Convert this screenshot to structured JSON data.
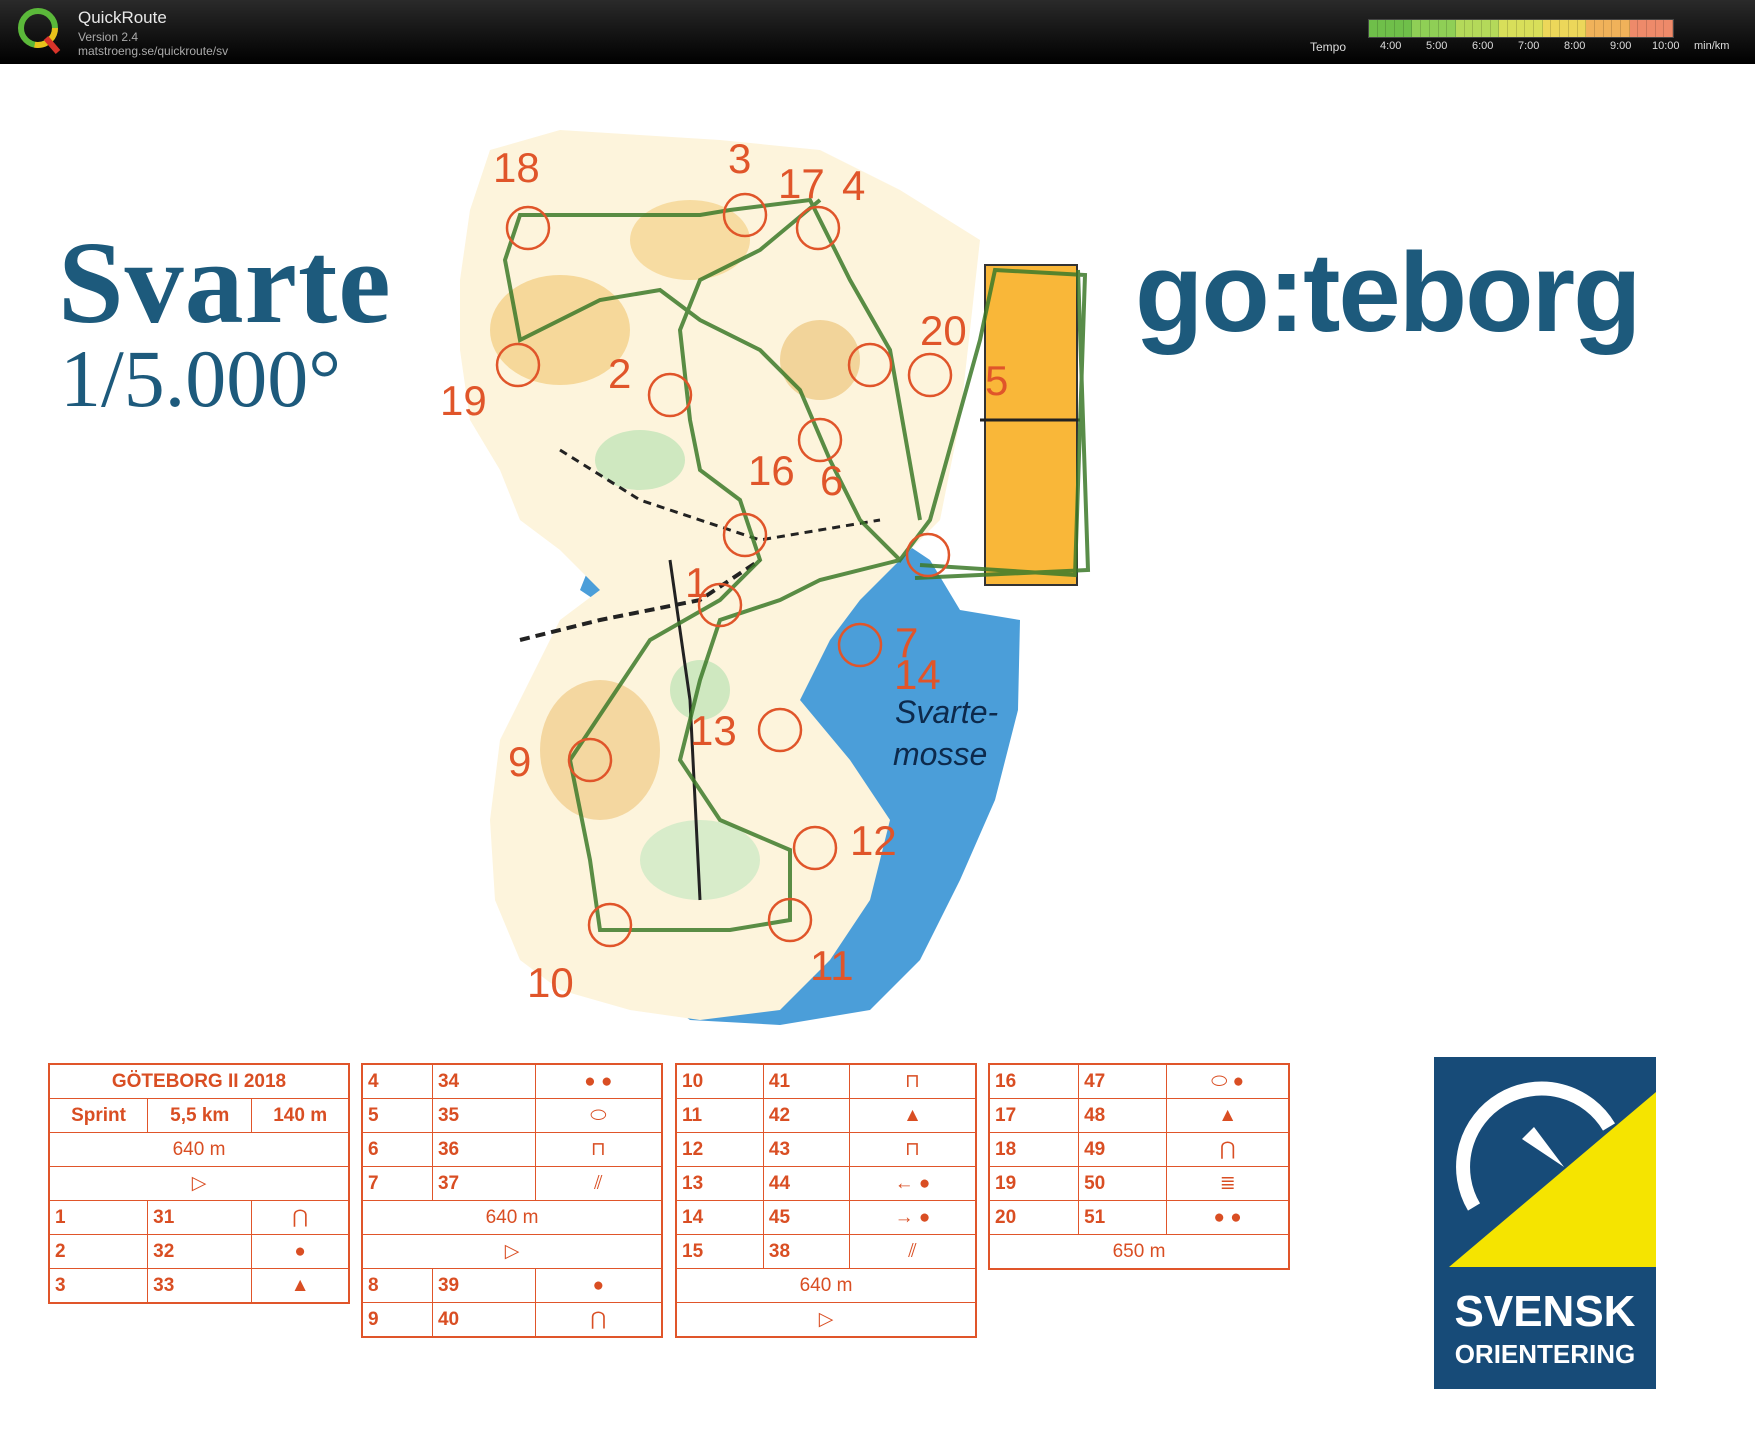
{
  "app": {
    "name": "QuickRoute",
    "version": "Version 2.4",
    "url": "matstroeng.se/quickroute/sv"
  },
  "tempo": {
    "label": "Tempo",
    "ticks": [
      "4:00",
      "5:00",
      "6:00",
      "7:00",
      "8:00",
      "9:00",
      "10:00"
    ],
    "unit": "min/km",
    "colors": [
      "#6fbf4a",
      "#8fcf56",
      "#b4d95a",
      "#d8df5a",
      "#ecd75a",
      "#f0b25a",
      "#ee8a6a"
    ]
  },
  "map": {
    "title": "Svarte",
    "scale": "1/5.000°",
    "city": "go:teborg",
    "label_lake": [
      "Svarte-",
      "mosse"
    ],
    "controls": [
      "18",
      "3",
      "17",
      "4",
      "20",
      "5",
      "19",
      "2",
      "16",
      "6",
      "1",
      "7",
      "14",
      "13",
      "9",
      "12",
      "10",
      "11"
    ],
    "water_color": "#4b9ed9",
    "route_color": "#3d7a2a",
    "control_color": "#e0552a"
  },
  "descriptions": {
    "event": "GÖTEBORG II 2018",
    "class": "Sprint",
    "length": "5,5 km",
    "climb": "140 m",
    "leg1": "640 m",
    "leg2": "640 m",
    "leg3": "640 m",
    "leg4": "650 m",
    "rows1": [
      {
        "n": "1",
        "c": "31"
      },
      {
        "n": "2",
        "c": "32"
      },
      {
        "n": "3",
        "c": "33"
      }
    ],
    "rows2": [
      {
        "n": "4",
        "c": "34"
      },
      {
        "n": "5",
        "c": "35"
      },
      {
        "n": "6",
        "c": "36"
      },
      {
        "n": "7",
        "c": "37"
      },
      {
        "n": "8",
        "c": "39"
      },
      {
        "n": "9",
        "c": "40"
      }
    ],
    "rows3": [
      {
        "n": "10",
        "c": "41"
      },
      {
        "n": "11",
        "c": "42"
      },
      {
        "n": "12",
        "c": "43"
      },
      {
        "n": "13",
        "c": "44"
      },
      {
        "n": "14",
        "c": "45"
      },
      {
        "n": "15",
        "c": "38"
      }
    ],
    "rows4": [
      {
        "n": "16",
        "c": "47"
      },
      {
        "n": "17",
        "c": "48"
      },
      {
        "n": "18",
        "c": "49"
      },
      {
        "n": "19",
        "c": "50"
      },
      {
        "n": "20",
        "c": "51"
      }
    ]
  },
  "logo": {
    "line1": "SVENSK",
    "line2": "ORIENTERING"
  }
}
